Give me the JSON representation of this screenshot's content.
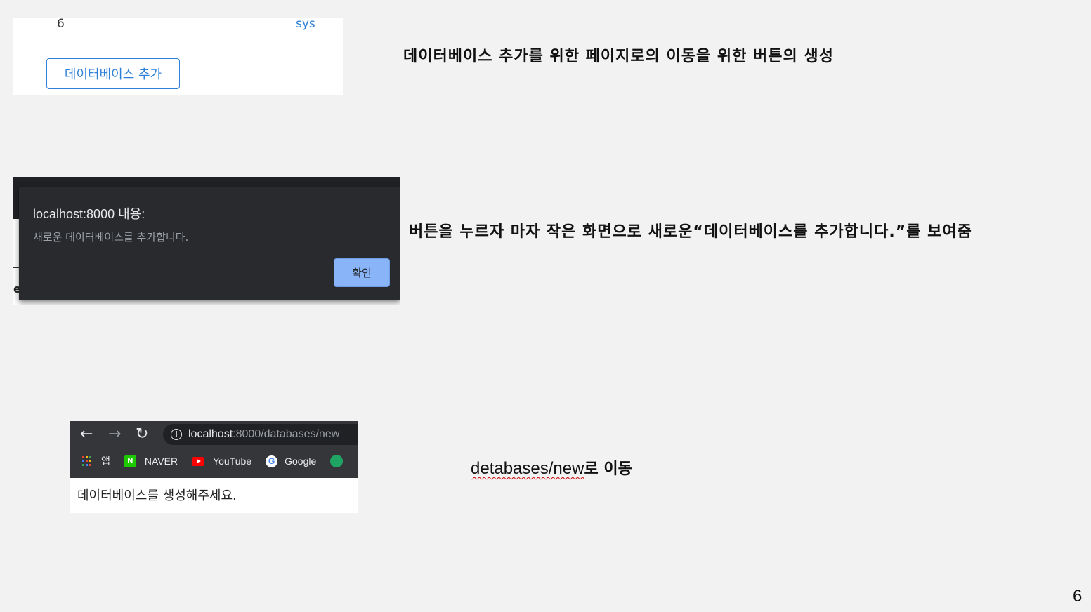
{
  "panel1": {
    "row_num": "6",
    "row_owner": "sys",
    "add_button_label": "데이터베이스 추가"
  },
  "captions": {
    "caption1": "데이터베이스 추가를 위한 페이지로의 이동을 위한 버튼의 생성",
    "caption2": "버튼을 누르자 마자 작은 화면으로 새로운“데이터베이스를  추가합니다.”를 보여줌",
    "caption3_path": "detabases/new",
    "caption3_suffix": "로 이동"
  },
  "alert": {
    "background_letter": "e",
    "title": "localhost:8000 내용:",
    "message": "새로운 데이터베이스를 추가합니다.",
    "ok_label": "확인"
  },
  "browser": {
    "back_icon": "←",
    "forward_icon": "→",
    "reload_icon": "↻",
    "info_icon": "i",
    "url_host": "localhost",
    "url_path": ":8000/databases/new",
    "bookmarks": [
      "앱",
      "NAVER",
      "YouTube",
      "Google"
    ],
    "naver_letter": "N",
    "google_letter": "G",
    "page_text": "데이터베이스를 생성해주세요."
  },
  "slide_number": "6",
  "colors": {
    "accent_blue": "#2f80d8",
    "dialog_bg": "#292a2d",
    "dialog_button": "#8ab4f8",
    "browser_bar": "#35363a"
  }
}
